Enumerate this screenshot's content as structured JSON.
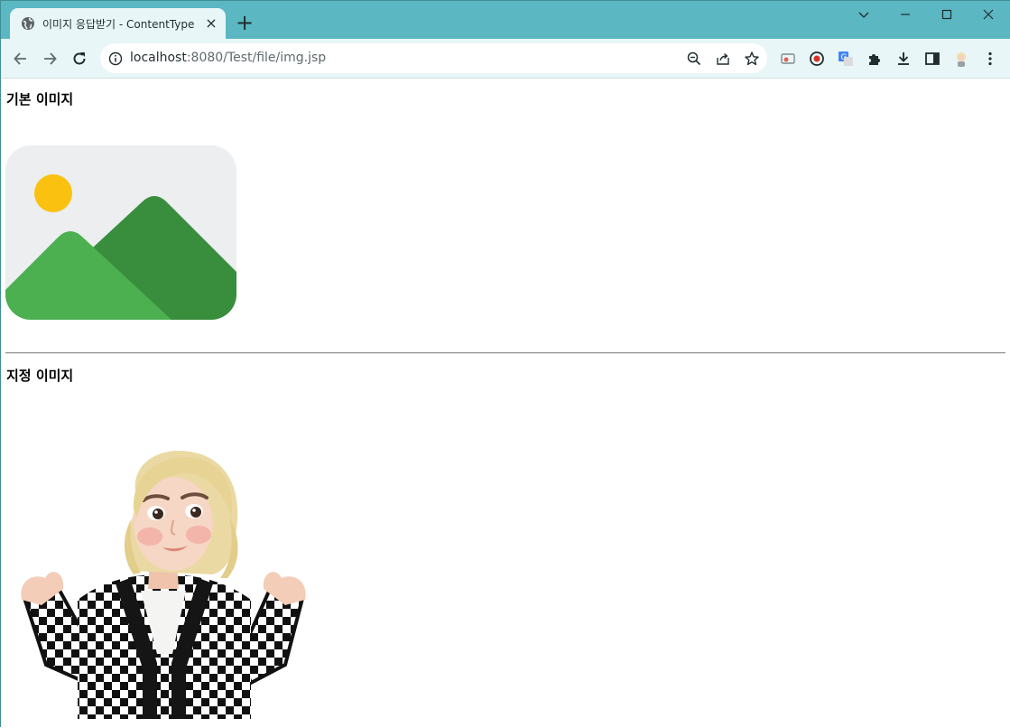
{
  "browser": {
    "tab": {
      "title": "이미지 응답받기 - ContentType"
    },
    "address": {
      "host": "localhost",
      "path": ":8080/Test/file/img.jsp"
    }
  },
  "page": {
    "heading_default": "기본 이미지",
    "heading_custom": "지정 이미지"
  },
  "colors": {
    "titlebar": "#5bb7c1",
    "toolbar": "#e8f6f7",
    "sun": "#fbc111",
    "mountain_front": "#4caf50",
    "mountain_back": "#388e3c"
  },
  "icons": [
    "globe-icon",
    "close-icon",
    "plus-icon",
    "back-icon",
    "forward-icon",
    "reload-icon",
    "info-icon",
    "zoom-icon",
    "share-icon",
    "star-icon",
    "extensions-icon",
    "download-icon",
    "side-panel-icon",
    "profile-icon",
    "menu-icon"
  ]
}
